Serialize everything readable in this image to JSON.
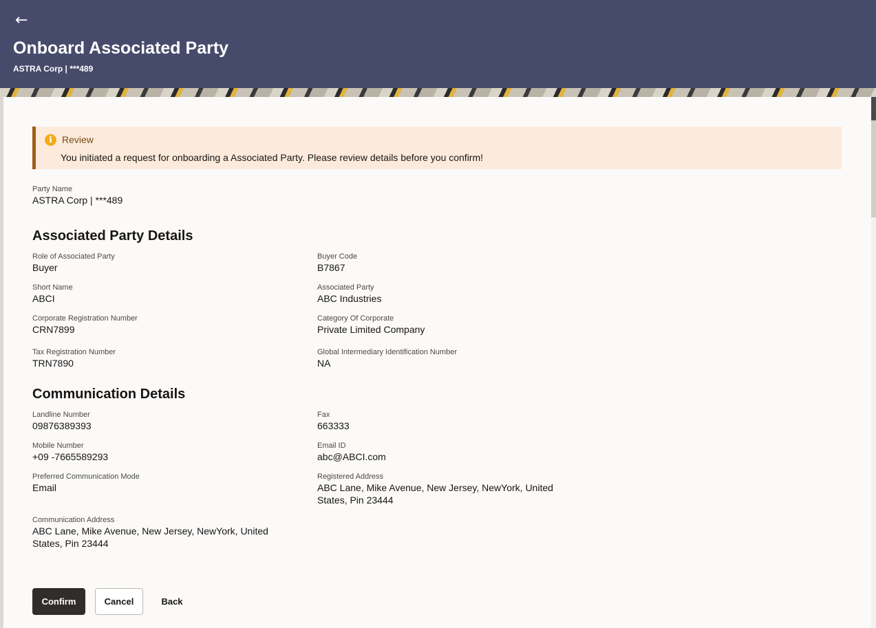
{
  "header": {
    "back_icon": "arrow-left-icon",
    "title": "Onboard Associated Party",
    "subtitle": "ASTRA Corp | ***489"
  },
  "alert": {
    "icon": "info-icon",
    "title": "Review",
    "message": "You initiated a request for onboarding a Associated Party. Please review details before you confirm!"
  },
  "party": {
    "label": "Party Name",
    "value": "ASTRA Corp | ***489"
  },
  "associated_party_details": {
    "heading": "Associated Party Details",
    "fields": [
      {
        "label": "Role of Associated Party",
        "value": "Buyer"
      },
      {
        "label": "Buyer Code",
        "value": "B7867"
      },
      {
        "label": "Short Name",
        "value": "ABCI"
      },
      {
        "label": "Associated Party",
        "value": "ABC Industries"
      },
      {
        "label": "Corporate Registration Number",
        "value": "CRN7899"
      },
      {
        "label": "Category Of Corporate",
        "value": "Private Limited Company"
      },
      {
        "label": "Tax Registration Number",
        "value": "TRN7890"
      },
      {
        "label": "Global Intermediary Identification Number",
        "value": "NA"
      }
    ]
  },
  "communication_details": {
    "heading": "Communication Details",
    "fields": [
      {
        "label": "Landline Number",
        "value": "09876389393"
      },
      {
        "label": "Fax",
        "value": "663333"
      },
      {
        "label": "Mobile Number",
        "value": "+09 -7665589293"
      },
      {
        "label": "Email ID",
        "value": "abc@ABCI.com"
      },
      {
        "label": "Preferred Communication Mode",
        "value": "Email"
      },
      {
        "label": "Registered Address",
        "value": "ABC Lane, Mike Avenue, New Jersey, NewYork, United States, Pin 23444"
      },
      {
        "label": "Communication Address",
        "value": "ABC Lane, Mike Avenue, New Jersey, NewYork, United States, Pin 23444"
      }
    ]
  },
  "actions": {
    "confirm": "Confirm",
    "cancel": "Cancel",
    "back": "Back"
  }
}
